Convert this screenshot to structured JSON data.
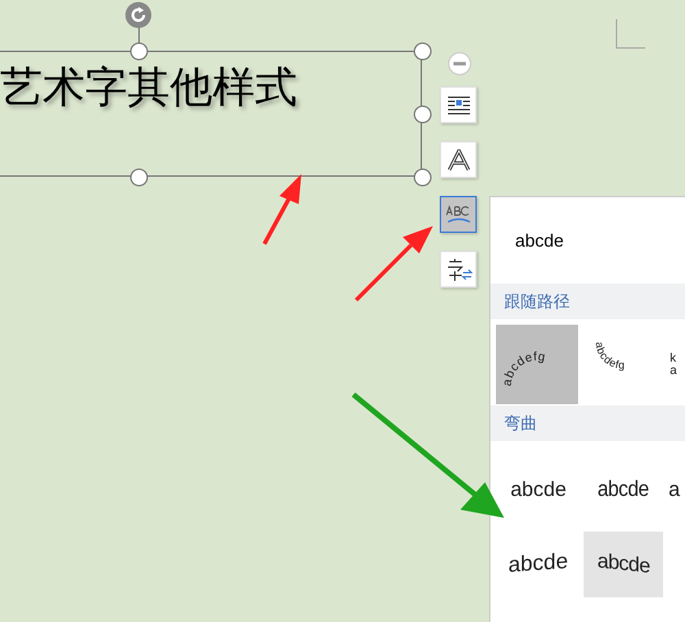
{
  "wordart": {
    "text": "艺术字其他样式"
  },
  "toolbar": [
    {
      "kind": "wrap",
      "selected": false
    },
    {
      "kind": "style",
      "selected": false
    },
    {
      "kind": "effect",
      "selected": true
    },
    {
      "kind": "direction",
      "selected": false
    }
  ],
  "panel": {
    "none_sample": "abcde",
    "sections": [
      {
        "title": "跟随路径",
        "items": [
          {
            "kind": "arc",
            "sample": "abcdefg",
            "selected": true
          },
          {
            "kind": "circle",
            "sample": "abcdefg",
            "selected": false
          },
          {
            "kind": "cut",
            "sample": "ka",
            "selected": false
          }
        ]
      },
      {
        "title": "弯曲",
        "items": [
          {
            "kind": "plain",
            "sample": "abcde",
            "selected": false
          },
          {
            "kind": "tall",
            "sample": "abcde",
            "selected": false
          },
          {
            "kind": "cut",
            "sample": "a",
            "selected": false
          },
          {
            "kind": "wave",
            "sample": "abcde",
            "selected": false
          },
          {
            "kind": "arch",
            "sample": "abcde",
            "selected": true
          }
        ]
      }
    ]
  }
}
